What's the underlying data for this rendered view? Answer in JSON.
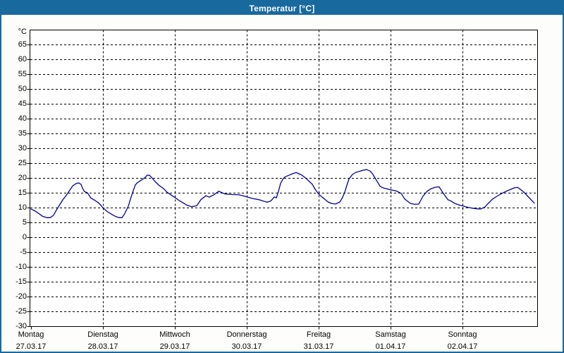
{
  "window": {
    "title": "Temperatur [°C]"
  },
  "colors": {
    "titlebar_bg": "#17699e",
    "titlebar_text": "#ffffff",
    "window_border": "#17699e",
    "background": "#fdfdfb",
    "plot_background": "#ffffff",
    "grid_color": "#000000",
    "axis_color": "#000000",
    "series_color": "#0000a0"
  },
  "chart_data": {
    "type": "line",
    "title": "Temperatur [°C]",
    "ylabel": "°C",
    "xlabel": "",
    "ylim": [
      -30,
      70
    ],
    "y_ticks": [
      65,
      60,
      55,
      50,
      45,
      40,
      35,
      30,
      25,
      20,
      15,
      10,
      5,
      0,
      -5,
      -10,
      -15,
      -20,
      -25,
      -30
    ],
    "grid": "dashed",
    "legend": "none",
    "hours_per_day": 24,
    "x_range_hours": [
      0,
      168
    ],
    "x_axis_days": [
      {
        "name": "Montag",
        "date": "27.03.17"
      },
      {
        "name": "Dienstag",
        "date": "28.03.17"
      },
      {
        "name": "Mittwoch",
        "date": "29.03.17"
      },
      {
        "name": "Donnerstag",
        "date": "30.03.17"
      },
      {
        "name": "Freitag",
        "date": "31.03.17"
      },
      {
        "name": "Samstag",
        "date": "01.04.17"
      },
      {
        "name": "Sonntag",
        "date": "02.04.17"
      }
    ],
    "series": [
      {
        "name": "Temperatur",
        "color": "#0000a0",
        "x_hours": [
          0,
          1.4,
          2.6,
          3.8,
          5.2,
          6.4,
          7.5,
          8.5,
          9.4,
          10.6,
          11.8,
          12.9,
          13.9,
          15,
          15.9,
          16.7,
          17.2,
          17.8,
          18.8,
          20,
          21.2,
          22.4,
          23.3,
          24,
          25.4,
          27.1,
          28.2,
          29.4,
          30.4,
          31.3,
          32.5,
          33.2,
          34.1,
          34.8,
          35.5,
          36.7,
          37.9,
          38.8,
          39.5,
          40.2,
          41.4,
          42.6,
          44.2,
          45.4,
          47.1,
          48,
          49.4,
          50.6,
          52,
          53.6,
          55.3,
          56.7,
          58.4,
          59.5,
          61.2,
          62.6,
          63.8,
          64.7,
          67.1,
          69.4,
          71.3,
          72,
          74.1,
          76,
          77.9,
          78.8,
          80,
          81.2,
          81.9,
          82.6,
          83.3,
          84.2,
          84.9,
          86.1,
          87.3,
          88.5,
          89.6,
          90.6,
          91.8,
          92.9,
          93.9,
          94.8,
          96,
          97.2,
          97.9,
          99.1,
          100.2,
          101.6,
          103.1,
          104,
          104.7,
          105.4,
          106.1,
          107.3,
          108.5,
          109.6,
          110.8,
          112,
          113.2,
          114.1,
          115.3,
          116.5,
          117.6,
          118.8,
          120,
          121.9,
          123.5,
          124.7,
          126.6,
          128,
          129.4,
          130.8,
          132.2,
          133.6,
          135.1,
          136.2,
          137.6,
          139.1,
          140.2,
          141.4,
          143.1,
          144,
          145.4,
          147.1,
          148.7,
          150.1,
          151.5,
          152.5,
          154.1,
          155.5,
          157.2,
          158.6,
          160,
          161.4,
          162.4,
          163.5,
          164.7,
          165.9,
          167.1,
          168
        ],
        "values": [
          9.5,
          8.8,
          8,
          7.1,
          6.6,
          6.6,
          7.4,
          9.2,
          10.7,
          12.6,
          14.2,
          15.8,
          17.3,
          18.1,
          18.3,
          17.8,
          16.5,
          15.4,
          15,
          13.2,
          12.5,
          11.7,
          10.8,
          9.9,
          8.7,
          7.6,
          7,
          6.6,
          6.6,
          8,
          10.5,
          12.9,
          15.6,
          17.6,
          18.4,
          19.2,
          20,
          20.9,
          20.9,
          20.2,
          18.8,
          17.6,
          16.4,
          15.2,
          14,
          13.4,
          12.4,
          11.7,
          10.8,
          10.3,
          10.6,
          12.7,
          14,
          13.5,
          14.4,
          15.5,
          15,
          14.6,
          14.4,
          14.3,
          13.8,
          13.6,
          13,
          12.7,
          12.1,
          11.8,
          12.2,
          13.6,
          13.3,
          15.5,
          18.2,
          19.8,
          20.4,
          20.9,
          21.4,
          21.8,
          21.3,
          20.8,
          19.8,
          18.8,
          17.8,
          16.2,
          14.6,
          13.5,
          12.9,
          11.9,
          11.4,
          11.2,
          11.9,
          13.5,
          15.2,
          17.5,
          19.6,
          21.2,
          21.9,
          22.2,
          22.6,
          22.8,
          22.3,
          21.2,
          19.2,
          17.2,
          16.6,
          16.3,
          16,
          15.6,
          14.8,
          12.9,
          11.4,
          11.1,
          11.2,
          13.8,
          15.5,
          16.4,
          16.9,
          17,
          14.8,
          12.7,
          12.2,
          11.4,
          10.8,
          10.6,
          10.2,
          9.8,
          9.6,
          9.5,
          10.2,
          11.3,
          12.9,
          13.8,
          14.8,
          15.5,
          16.1,
          16.7,
          16.8,
          16,
          15,
          13.7,
          12.4,
          11.5
        ]
      }
    ]
  }
}
